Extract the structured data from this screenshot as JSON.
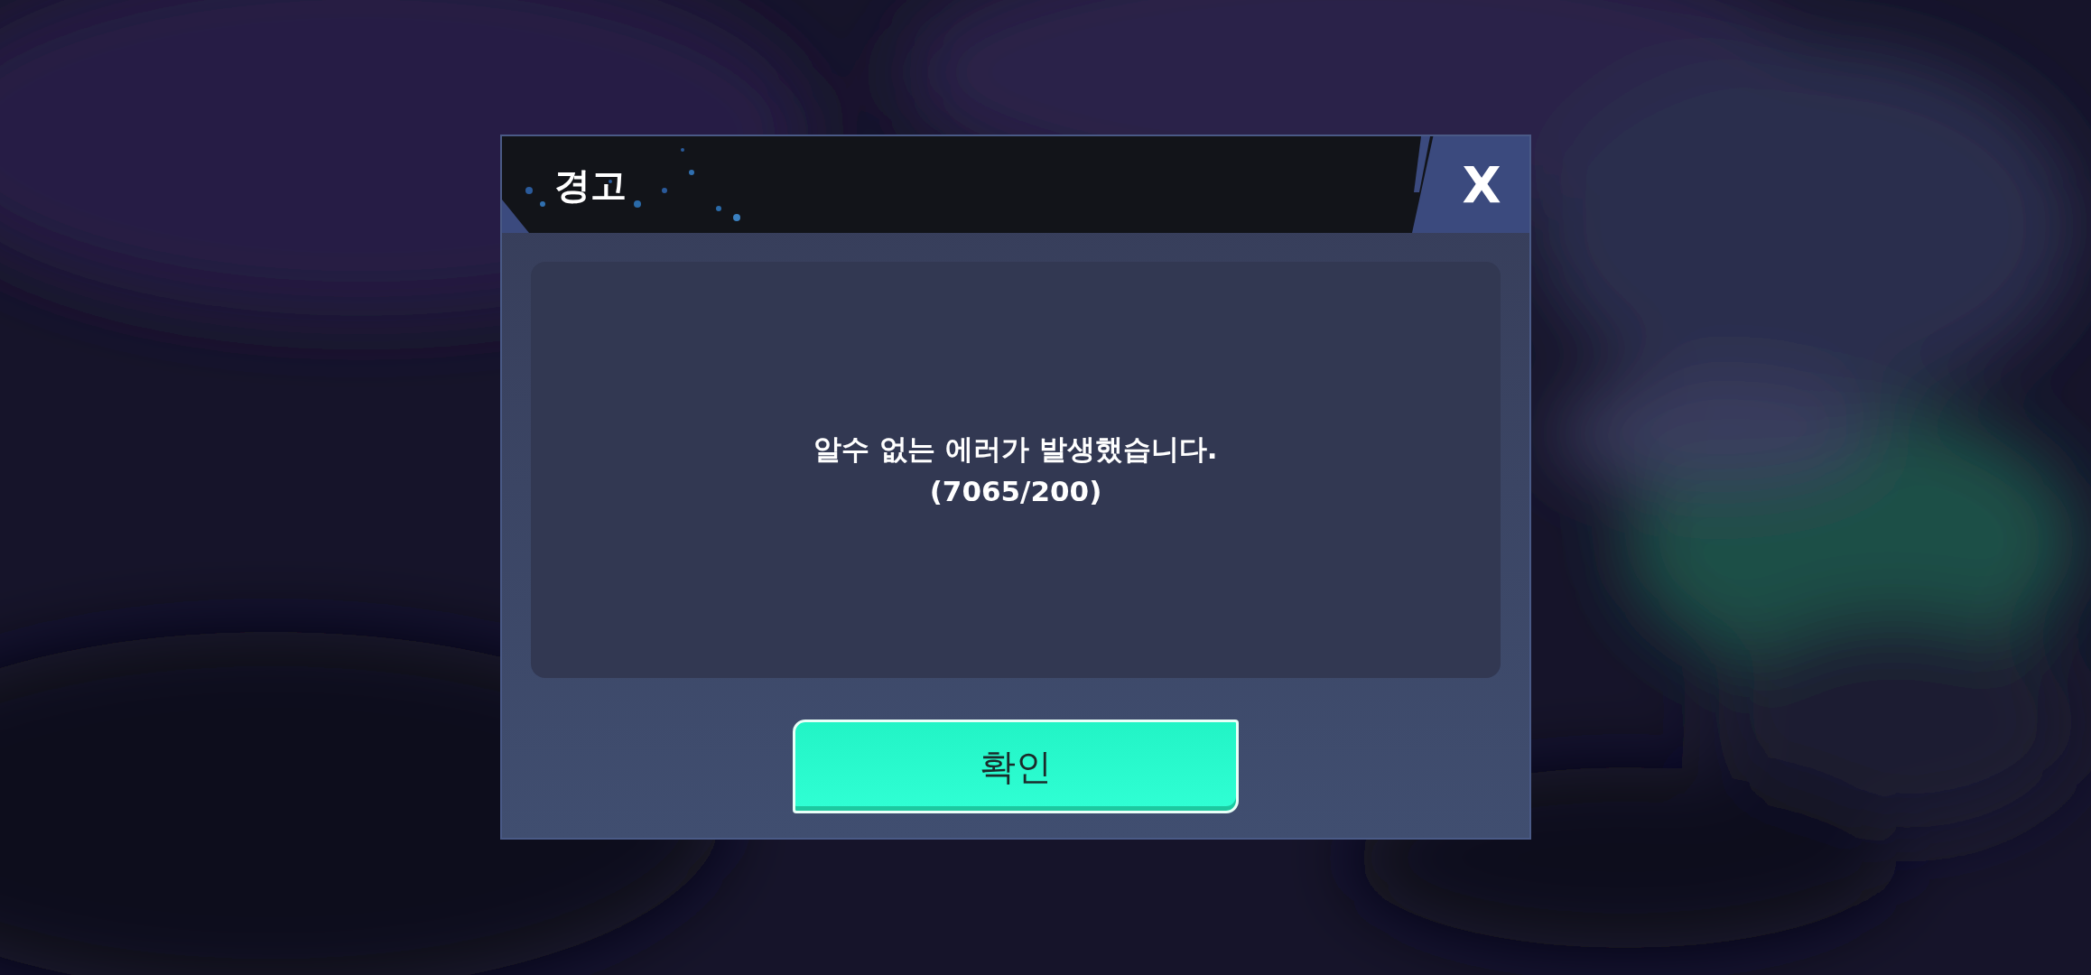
{
  "dialog": {
    "title": "경고",
    "close": "X",
    "message": "알수 없는 에러가 발생했습니다.",
    "code": "(7065/200)",
    "button": "확인"
  }
}
